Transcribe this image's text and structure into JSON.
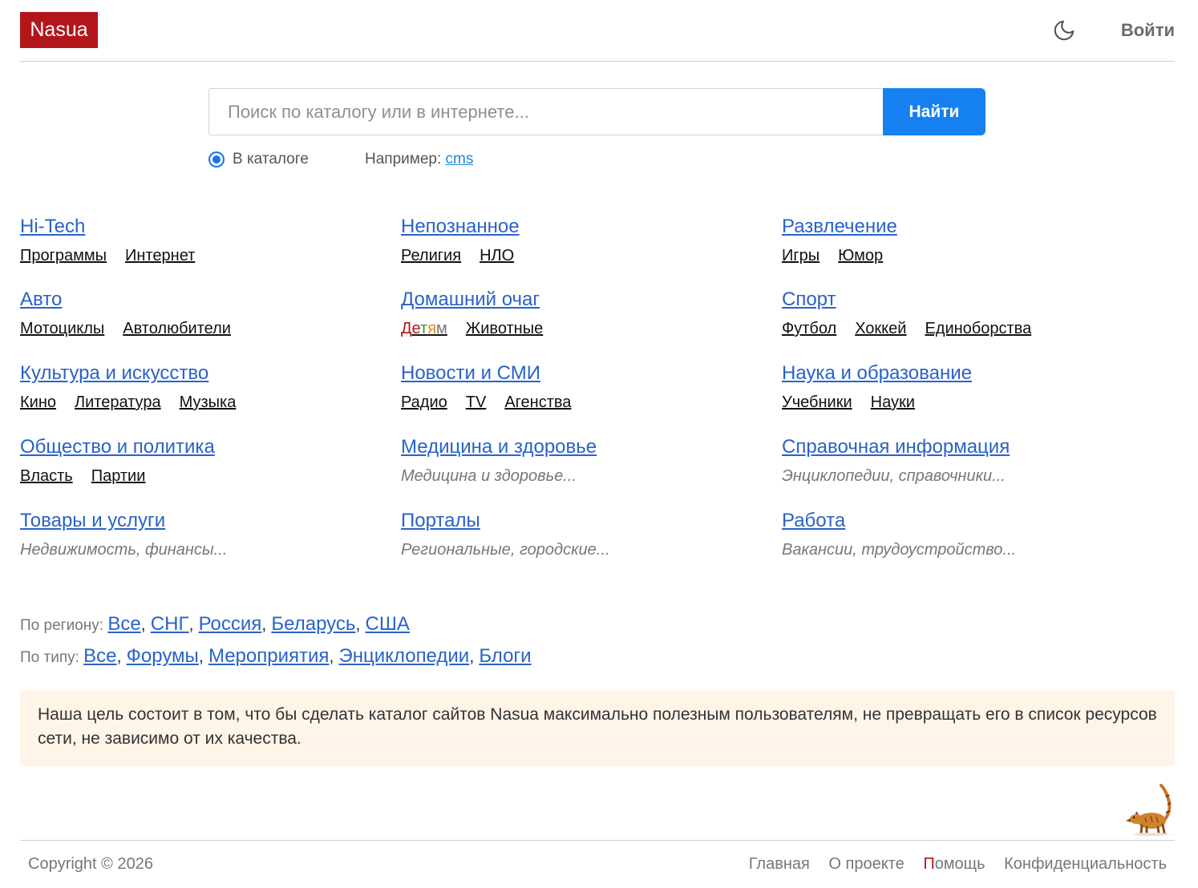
{
  "header": {
    "logo": "Nasua",
    "login": "Войти",
    "theme_icon": "moon-icon"
  },
  "search": {
    "placeholder": "Поиск по каталогу или в интернете...",
    "button": "Найти",
    "radio_label": "В каталоге",
    "example_prefix": "Например:",
    "example_link": "cms"
  },
  "categories": [
    {
      "title": "Hi-Tech",
      "subs": [
        "Программы",
        "Интернет"
      ]
    },
    {
      "title": "Непознанное",
      "subs": [
        "Религия",
        "НЛО"
      ]
    },
    {
      "title": "Развлечение",
      "subs": [
        "Игры",
        "Юмор"
      ]
    },
    {
      "title": "Авто",
      "subs": [
        "Мотоциклы",
        "Автолюбители"
      ]
    },
    {
      "title": "Домашний очаг",
      "subs": [
        "Детям",
        "Животные"
      ]
    },
    {
      "title": "Спорт",
      "subs": [
        "Футбол",
        "Хоккей",
        "Единоборства"
      ]
    },
    {
      "title": "Культура и искусство",
      "subs": [
        "Кино",
        "Литература",
        "Музыка"
      ]
    },
    {
      "title": "Новости и СМИ",
      "subs": [
        "Радио",
        "TV",
        "Агенства"
      ]
    },
    {
      "title": "Наука и образование",
      "subs": [
        "Учебники",
        "Науки"
      ]
    },
    {
      "title": "Общество и политика",
      "subs": [
        "Власть",
        "Партии"
      ]
    },
    {
      "title": "Медицина и здоровье",
      "desc": "Медицина и здоровье..."
    },
    {
      "title": "Справочная информация",
      "desc": "Энциклопедии, справочники..."
    },
    {
      "title": "Товары и услуги",
      "desc": "Недвижимость, финансы..."
    },
    {
      "title": "Порталы",
      "desc": "Региональные, городские..."
    },
    {
      "title": "Работа",
      "desc": "Вакансии, трудоустройство..."
    }
  ],
  "filters": {
    "region_label": "По региону:",
    "region_links": [
      "Все",
      "СНГ",
      "Россия",
      "Беларусь",
      "США"
    ],
    "type_label": "По типу:",
    "type_links": [
      "Все",
      "Форумы",
      "Мероприятия",
      "Энциклопедии",
      "Блоги"
    ]
  },
  "mission": "Наша цель состоит в том, что бы сделать каталог сайтов Nasua максимально полезным пользователям, не превращать его в список ресурсов сети, не зависимо от их качества.",
  "footer": {
    "copyright": "Copyright © 2026",
    "links": [
      "Главная",
      "О проекте",
      "Помощь",
      "Конфиденциальность"
    ]
  },
  "colors": {
    "brand_red": "#b3161a",
    "search_blue": "#1581f0",
    "link_blue": "#2a62c9",
    "mission_bg": "#fff4e8"
  }
}
